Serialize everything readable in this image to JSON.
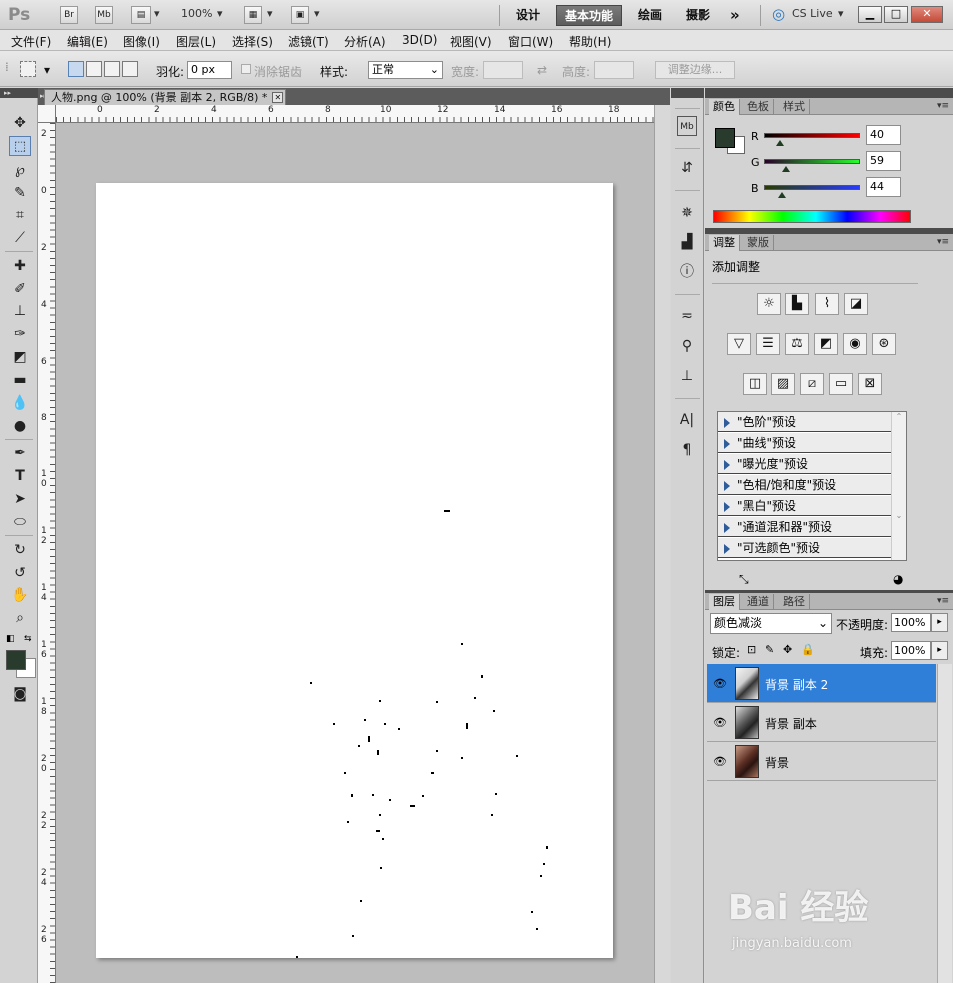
{
  "app": {
    "logo": "Ps",
    "bridge": "Br",
    "minibridge": "Mb",
    "zoom": "100%",
    "workspaces": [
      "设计",
      "基本功能",
      "绘画",
      "摄影"
    ],
    "active_workspace": "基本功能",
    "more": "»",
    "cslive": "CS Live"
  },
  "menu": [
    "文件(F)",
    "编辑(E)",
    "图像(I)",
    "图层(L)",
    "选择(S)",
    "滤镜(T)",
    "分析(A)",
    "3D(D)",
    "视图(V)",
    "窗口(W)",
    "帮助(H)"
  ],
  "options": {
    "feather_label": "羽化:",
    "feather_value": "0 px",
    "antialias_label": "消除锯齿",
    "style_label": "样式:",
    "style_value": "正常",
    "width_label": "宽度:",
    "height_label": "高度:",
    "refine_label": "调整边缘..."
  },
  "document": {
    "tab_title": "人物.png @ 100% (背景 副本 2, RGB/8) *",
    "hruler": [
      "0",
      "2",
      "4",
      "6",
      "8",
      "10",
      "12",
      "14",
      "16",
      "18"
    ],
    "vruler": [
      "2",
      "0",
      "2",
      "4",
      "6",
      "8",
      "1 0",
      "1 2",
      "1 4",
      "1 6",
      "1 8",
      "2 0",
      "2 2",
      "2 4",
      "2 6"
    ]
  },
  "color_panel": {
    "tabs": [
      "颜色",
      "色板",
      "样式"
    ],
    "r_label": "R",
    "r_value": "40",
    "g_label": "G",
    "g_value": "59",
    "b_label": "B",
    "b_value": "44",
    "foreground": "#283b2c"
  },
  "adjust_panel": {
    "tabs": [
      "调整",
      "蒙版"
    ],
    "title": "添加调整",
    "presets": [
      "\"色阶\"预设",
      "\"曲线\"预设",
      "\"曝光度\"预设",
      "\"色相/饱和度\"预设",
      "\"黑白\"预设",
      "\"通道混和器\"预设",
      "\"可选颜色\"预设"
    ]
  },
  "layers_panel": {
    "tabs": [
      "图层",
      "通道",
      "路径"
    ],
    "blend_mode": "颜色减淡",
    "opacity_label": "不透明度:",
    "opacity_value": "100%",
    "lock_label": "锁定:",
    "fill_label": "填充:",
    "fill_value": "100%",
    "layers": [
      {
        "name": "背景 副本 2"
      },
      {
        "name": "背景 副本"
      },
      {
        "name": "背景"
      }
    ]
  },
  "watermark": {
    "brand": "Bai 经验",
    "domain": "jingyan.baidu.com"
  }
}
